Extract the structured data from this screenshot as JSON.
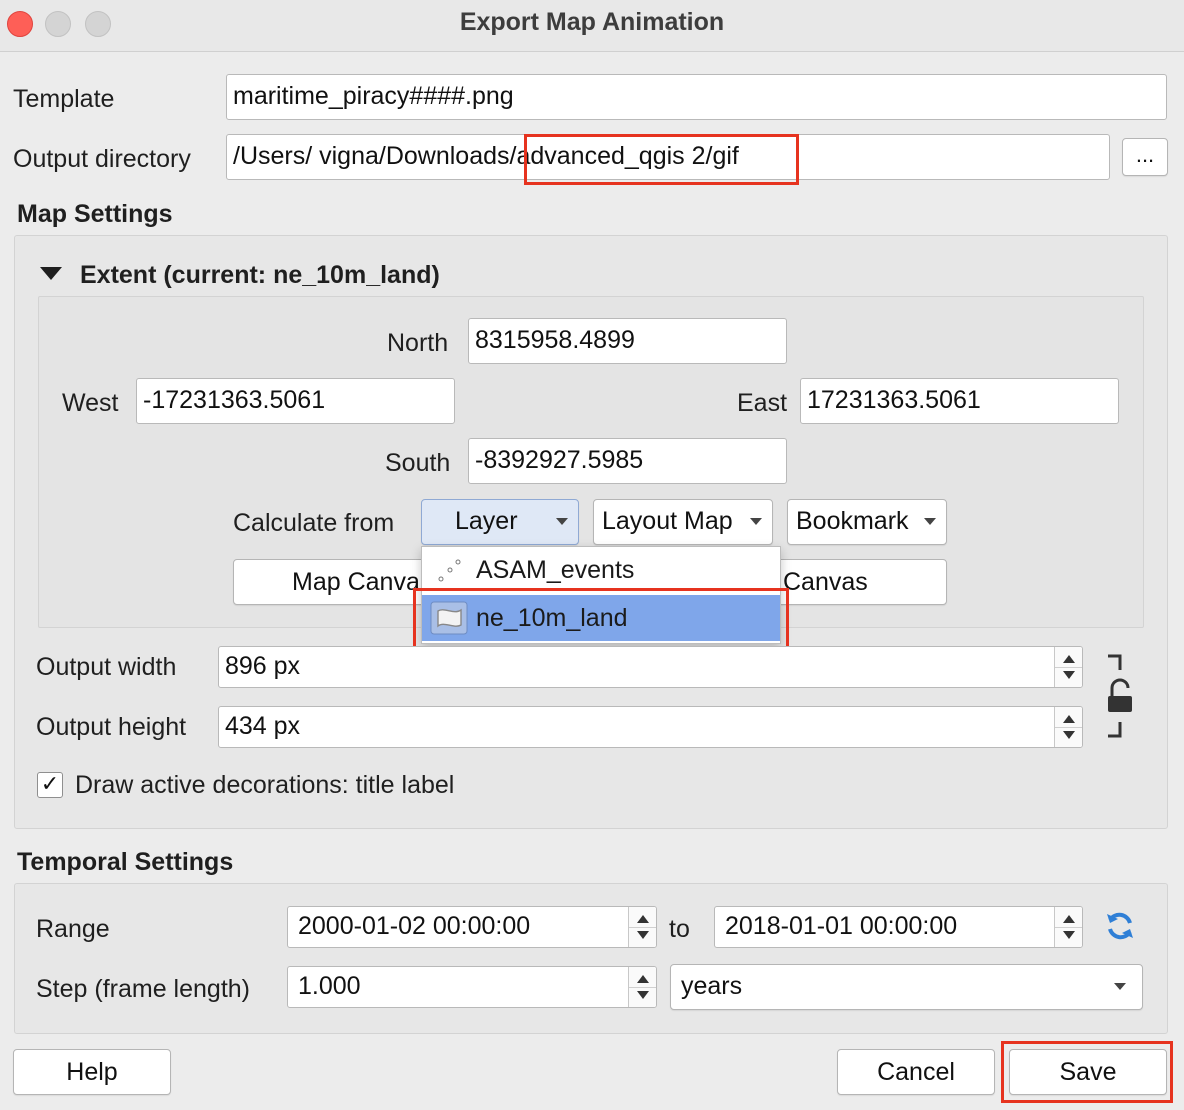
{
  "window": {
    "title": "Export Map Animation"
  },
  "template": {
    "label": "Template",
    "value": "maritime_piracy####.png"
  },
  "output_directory": {
    "label": "Output directory",
    "value_prefix": "/Users/ vigna/Downloads",
    "value_suffix": "/advanced_qgis 2/gif",
    "browse_label": "..."
  },
  "map_settings": {
    "title": "Map Settings",
    "extent": {
      "title": "Extent (current: ne_10m_land)",
      "north_label": "North",
      "north": "8315958.4899",
      "west_label": "West",
      "west": "-17231363.5061",
      "east_label": "East",
      "east": "17231363.5061",
      "south_label": "South",
      "south": "-8392927.5985",
      "calculate_label": "Calculate from",
      "layer_button": "Layer",
      "layout_map_button": "Layout Map",
      "bookmark_button": "Bookmark",
      "map_canvas_button_partial": "Map Canva",
      "canvas_button_partial": "Canvas"
    },
    "layer_menu": {
      "items": [
        {
          "label": "ASAM_events",
          "icon": "point-layer-icon",
          "selected": false
        },
        {
          "label": "ne_10m_land",
          "icon": "polygon-layer-icon",
          "selected": true
        }
      ]
    },
    "output_width_label": "Output width",
    "output_width": "896 px",
    "output_height_label": "Output height",
    "output_height": "434 px",
    "draw_decorations_label": "Draw active decorations: title label",
    "draw_decorations_check": "✓"
  },
  "temporal_settings": {
    "title": "Temporal Settings",
    "range_label": "Range",
    "range_start": "2000-01-02 00:00:00",
    "to_label": "to",
    "range_end": "2018-01-01 00:00:00",
    "step_label": "Step (frame length)",
    "step_value": "1.000",
    "step_unit": "years"
  },
  "buttons": {
    "help": "Help",
    "cancel": "Cancel",
    "save": "Save"
  },
  "colors": {
    "highlight_red": "#e6331f",
    "selection_blue": "#7fa6ea"
  }
}
